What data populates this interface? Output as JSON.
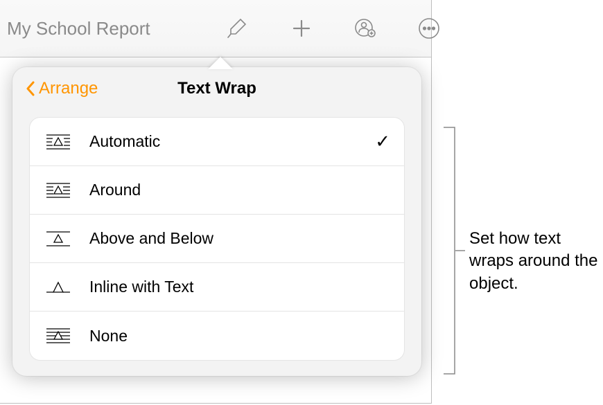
{
  "document": {
    "title": "My School Report"
  },
  "popover": {
    "back_label": "Arrange",
    "title": "Text Wrap",
    "items": [
      {
        "label": "Automatic",
        "selected": true
      },
      {
        "label": "Around",
        "selected": false
      },
      {
        "label": "Above and Below",
        "selected": false
      },
      {
        "label": "Inline with Text",
        "selected": false
      },
      {
        "label": "None",
        "selected": false
      }
    ]
  },
  "callout": {
    "text": "Set how text wraps around the object."
  }
}
